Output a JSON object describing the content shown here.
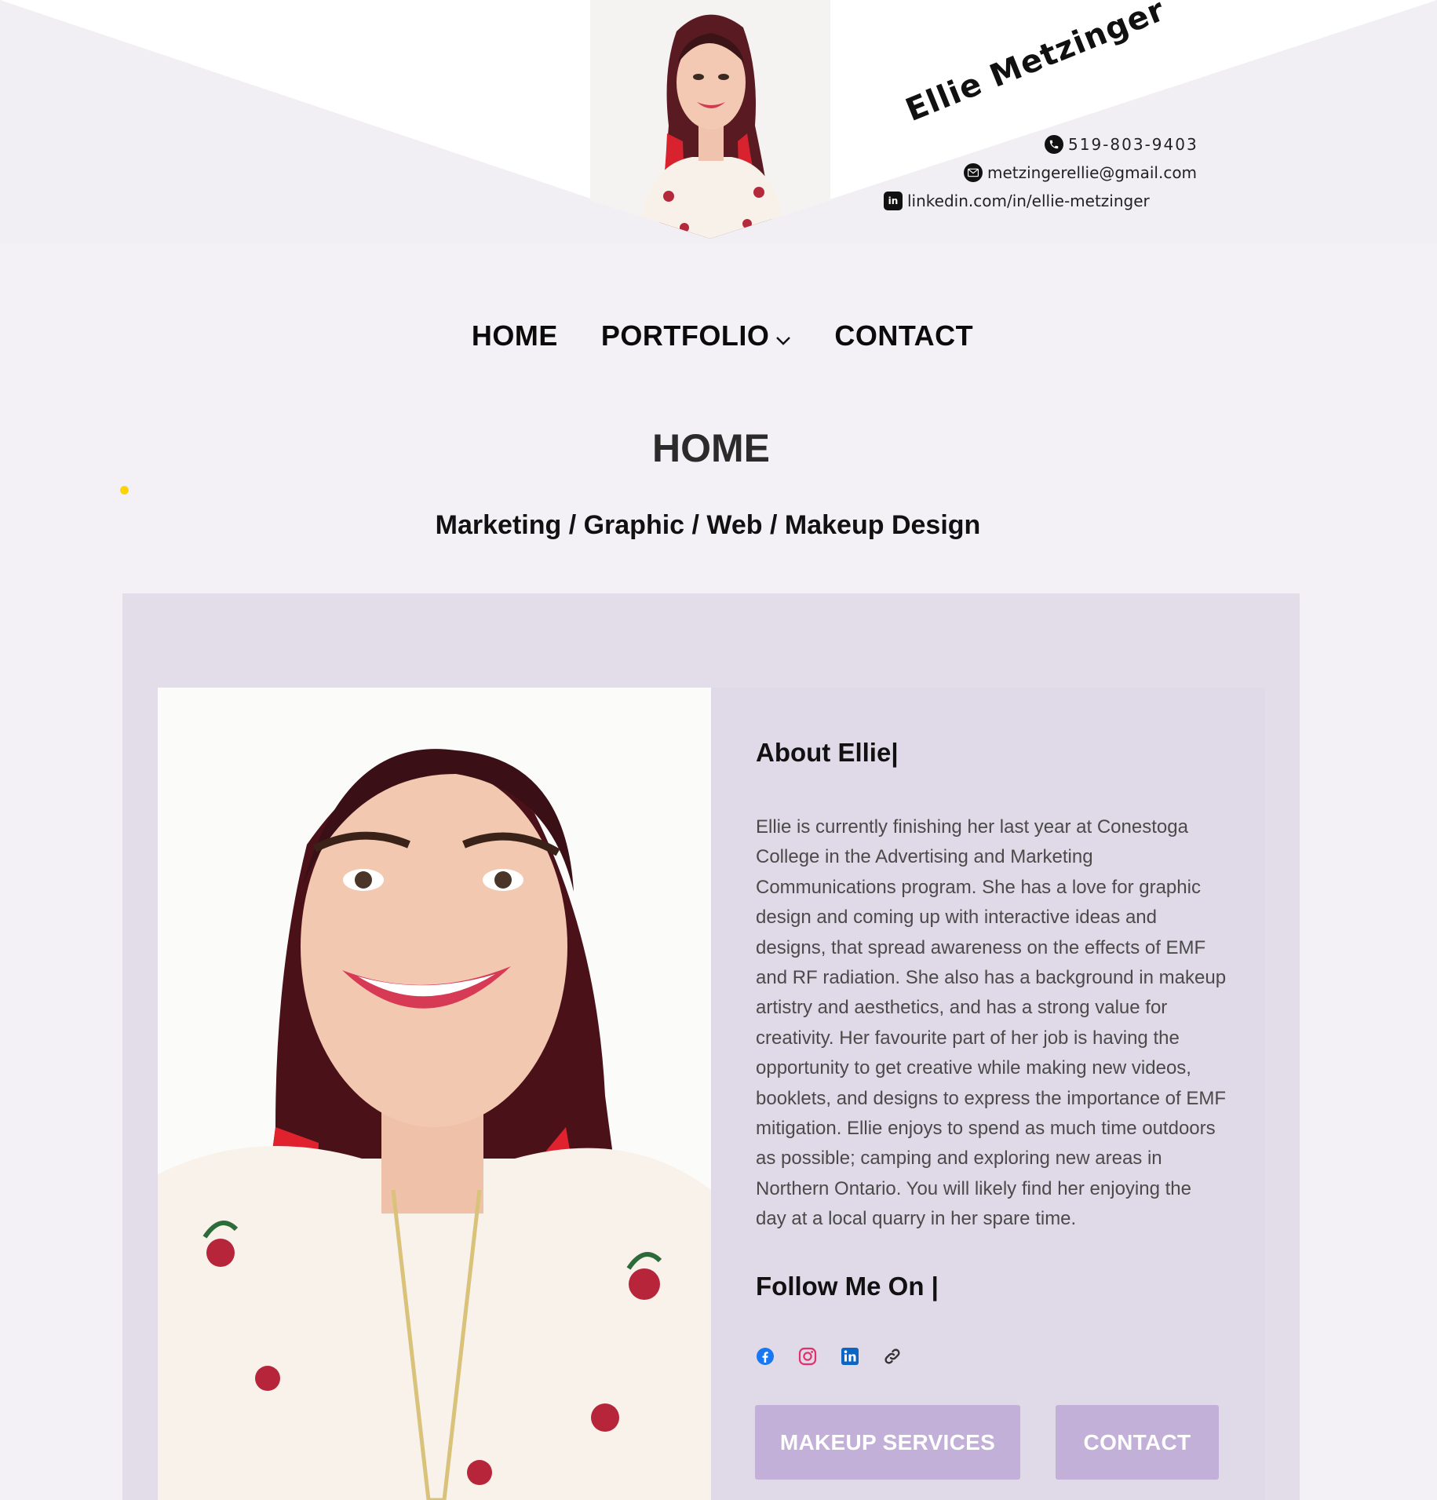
{
  "header": {
    "name": "Ellie Metzinger",
    "phone": "519-803-9403",
    "email": "metzingerellie@gmail.com",
    "linkedin": "linkedin.com/in/ellie-metzinger"
  },
  "nav": {
    "items": [
      {
        "label": "HOME"
      },
      {
        "label": "PORTFOLIO"
      },
      {
        "label": "CONTACT"
      }
    ]
  },
  "page": {
    "title": "HOME",
    "subtitle": "Marketing / Graphic / Web / Makeup Design"
  },
  "about": {
    "heading": "About Ellie|",
    "paragraph": "Ellie is currently finishing her last year at Conestoga College in the Advertising and Marketing Communications program. She has a love for graphic design and coming up with interactive ideas and designs, that spread awareness on the effects of EMF and RF radiation. She also has a background in makeup artistry and aesthetics, and has a strong value for creativity. Her favourite part of her job is having the opportunity to get creative while making new videos, booklets, and designs to express the importance of EMF mitigation. Ellie enjoys to spend as much time outdoors as possible; camping and exploring new areas in Northern Ontario. You will likely find her enjoying the day at a local quarry in her spare time.",
    "follow_heading": "Follow Me On |"
  },
  "social": [
    "facebook-icon",
    "instagram-icon",
    "linkedin-icon",
    "link-icon"
  ],
  "buttons": {
    "makeup": "MAKEUP SERVICES",
    "contact": "CONTACT"
  },
  "colors": {
    "background": "#f3f1f6",
    "card": "#e3dde9",
    "button": "#c3b0d8",
    "facebook": "#1877f2",
    "instagram": "#e1306c",
    "linkedin": "#0a66c2"
  }
}
